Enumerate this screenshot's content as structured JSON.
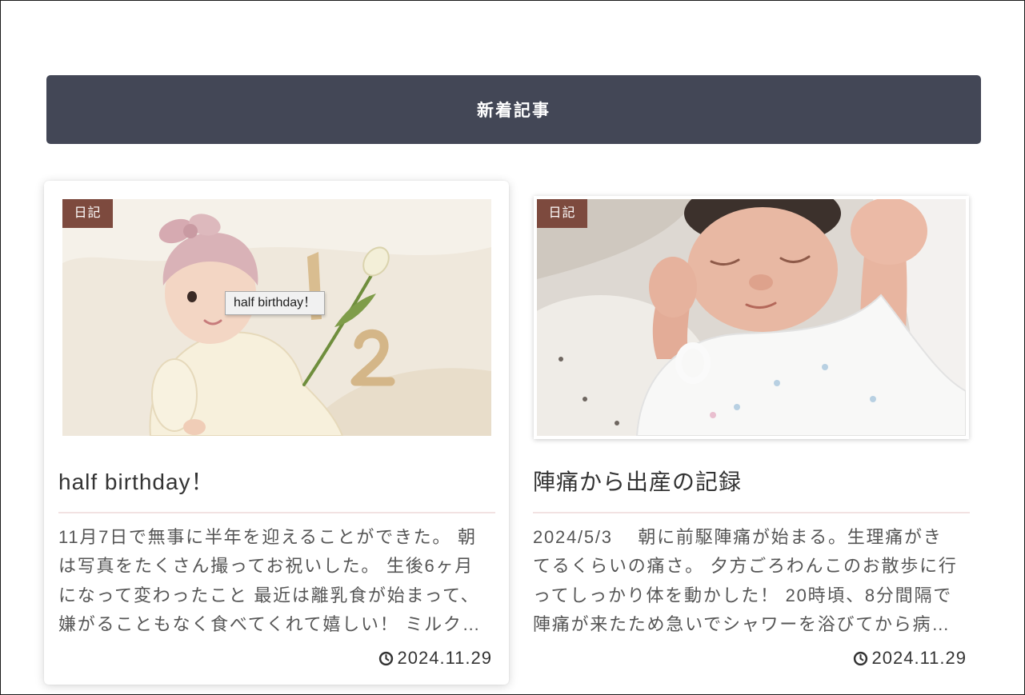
{
  "colors": {
    "header": "#434756",
    "badge": "#7d4a3e",
    "divider": "#f2e2e2",
    "text": "#333333",
    "excerpt": "#555555"
  },
  "section": {
    "title": "新着記事"
  },
  "tooltip": {
    "text": "half birthday！"
  },
  "articles": [
    {
      "category": "日記",
      "title": "half birthday！",
      "excerpt_lines": [
        "11月7日で無事に半年を迎えることができた。 朝",
        "は写真をたくさん撮ってお祝いした。 生後6ヶ月",
        "になって変わったこと 最近は離乳食が始まって、",
        "嫌がることもなく食べてくれて嬉しい！ ミルク…"
      ],
      "date": "2024.11.29",
      "date_icon": "clock-icon"
    },
    {
      "category": "日記",
      "title": "陣痛から出産の記録",
      "excerpt_lines": [
        "2024/5/3　 朝に前駆陣痛が始まる。生理痛がき",
        "てるくらいの痛さ。 夕方ごろわんこのお散歩に行",
        "ってしっかり体を動かした！ 20時頃、8分間隔で",
        "陣痛が来たため急いでシャワーを浴びてから病…"
      ],
      "date": "2024.11.29",
      "date_icon": "clock-icon"
    }
  ]
}
